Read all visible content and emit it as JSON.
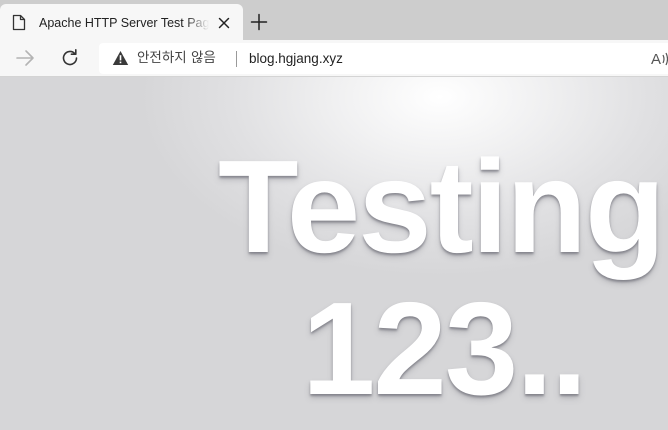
{
  "tab": {
    "title": "Apache HTTP Server Test Page p",
    "doc_icon": "document-icon",
    "close_icon": "close-icon",
    "new_tab_icon": "plus-icon"
  },
  "toolbar": {
    "forward_icon": "arrow-right-icon",
    "refresh_icon": "refresh-icon",
    "security_icon": "warning-triangle-icon",
    "security_label": "안전하지 않음",
    "url": "blog.hgjang.xyz",
    "read_aloud_label": "A))"
  },
  "content": {
    "heading_line1": "Testing",
    "heading_line2": "123.."
  },
  "colors": {
    "tabstrip_bg": "#cdcdcd",
    "tab_bg": "#f7f7f7",
    "page_bg": "#e0e0e2",
    "heading_text": "#ffffff"
  }
}
